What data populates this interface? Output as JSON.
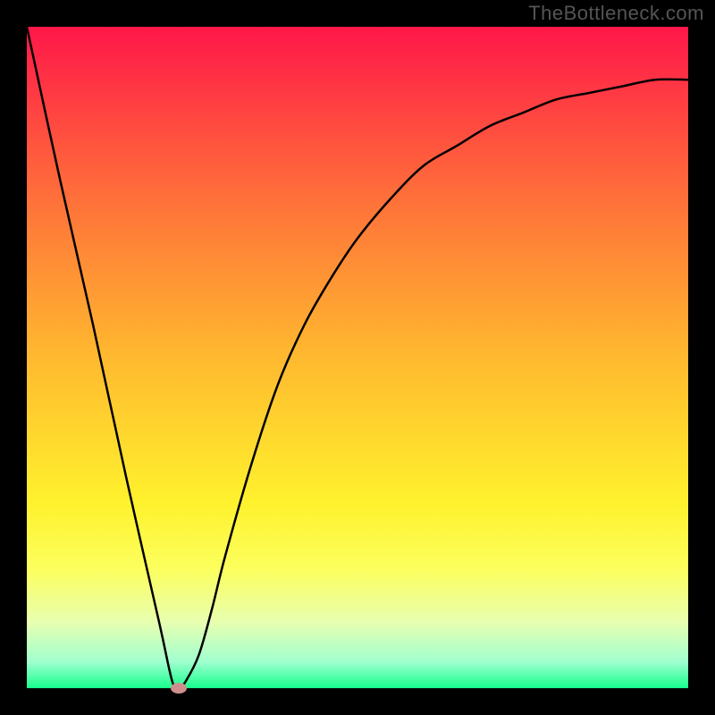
{
  "watermark": "TheBottleneck.com",
  "chart_data": {
    "type": "line",
    "title": "",
    "xlabel": "",
    "ylabel": "",
    "xlim": [
      0,
      100
    ],
    "ylim": [
      0,
      100
    ],
    "grid": false,
    "legend": false,
    "background_gradient": {
      "stops": [
        {
          "offset": 0.0,
          "color": "#ff1749"
        },
        {
          "offset": 0.25,
          "color": "#ff6d3a"
        },
        {
          "offset": 0.5,
          "color": "#ffb92f"
        },
        {
          "offset": 0.72,
          "color": "#fff22d"
        },
        {
          "offset": 0.82,
          "color": "#fcff5e"
        },
        {
          "offset": 0.9,
          "color": "#e8ffb0"
        },
        {
          "offset": 0.96,
          "color": "#a0ffcf"
        },
        {
          "offset": 1.0,
          "color": "#17ff8d"
        }
      ]
    },
    "series": [
      {
        "name": "bottleneck-curve",
        "color": "#000000",
        "x": [
          0,
          5,
          10,
          15,
          20,
          22,
          23,
          24,
          26,
          28,
          30,
          34,
          38,
          42,
          46,
          50,
          55,
          60,
          65,
          70,
          75,
          80,
          85,
          90,
          95,
          100
        ],
        "y": [
          100,
          77,
          55,
          32,
          10,
          1,
          0,
          1,
          5,
          12,
          20,
          34,
          46,
          55,
          62,
          68,
          74,
          79,
          82,
          85,
          87,
          89,
          90,
          91,
          92,
          92
        ]
      }
    ],
    "marker": {
      "x": 23,
      "y": 0,
      "color": "#cf8e8c"
    }
  }
}
